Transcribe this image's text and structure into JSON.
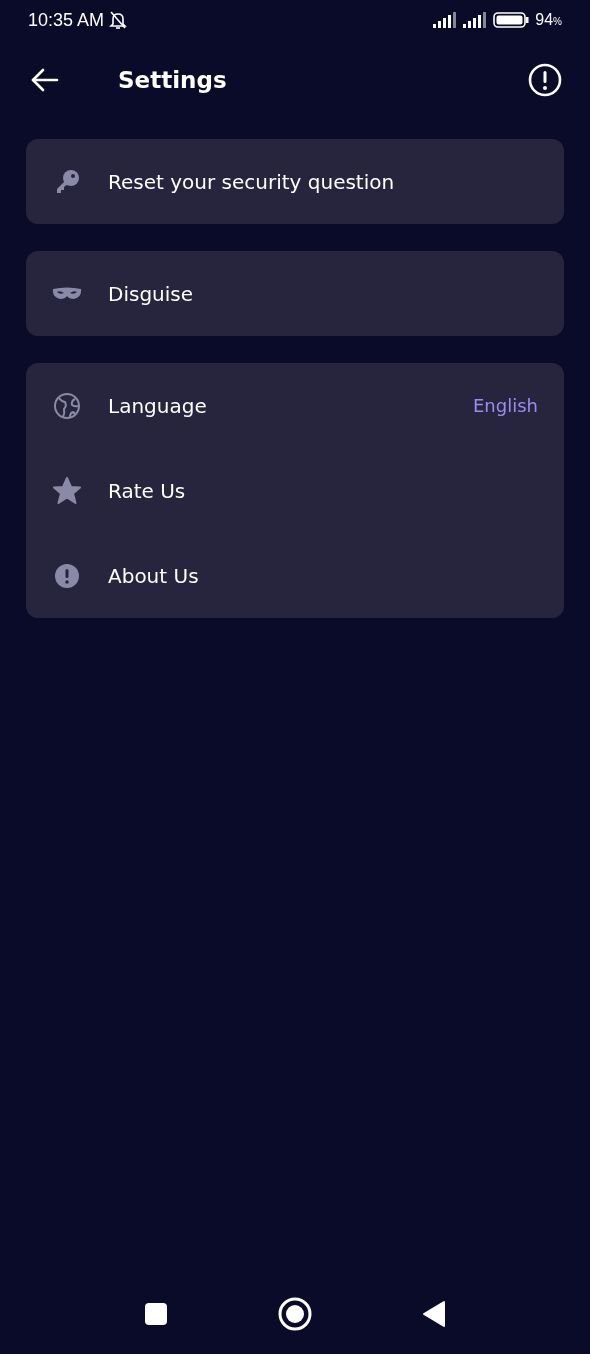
{
  "status_bar": {
    "time": "10:35 AM",
    "battery": "94",
    "battery_unit": "%"
  },
  "header": {
    "title": "Settings"
  },
  "groups": [
    {
      "items": [
        {
          "kind": "key",
          "label": "Reset your security question"
        }
      ]
    },
    {
      "items": [
        {
          "kind": "mask",
          "label": "Disguise"
        }
      ]
    },
    {
      "items": [
        {
          "kind": "globe",
          "label": "Language",
          "value": "English"
        },
        {
          "kind": "star",
          "label": "Rate Us"
        },
        {
          "kind": "info",
          "label": "About Us"
        }
      ]
    }
  ]
}
